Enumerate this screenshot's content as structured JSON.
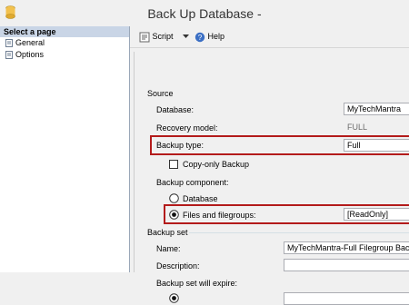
{
  "window": {
    "title": "Back Up Database -"
  },
  "left_pane": {
    "header": "Select a page",
    "items": [
      {
        "label": "General",
        "icon": "page-icon"
      },
      {
        "label": "Options",
        "icon": "page-icon"
      }
    ]
  },
  "toolbar": {
    "script_label": "Script",
    "help_label": "Help"
  },
  "source": {
    "section_label": "Source",
    "database_label": "Database:",
    "database_value": "MyTechMantra",
    "recovery_label": "Recovery model:",
    "recovery_value": "FULL",
    "backup_type_label": "Backup type:",
    "backup_type_value": "Full",
    "copy_only_label": "Copy-only Backup",
    "component_label": "Backup component:",
    "database_radio_label": "Database",
    "files_radio_label": "Files and filegroups:",
    "files_value": "[ReadOnly]"
  },
  "backup_set": {
    "section_label": "Backup set",
    "name_label": "Name:",
    "name_value": "MyTechMantra-Full Filegroup Backup",
    "description_label": "Description:",
    "description_value": "",
    "expire_label": "Backup set will expire:"
  },
  "colors": {
    "highlight_border": "#b31b1b",
    "selected_page_bg": "#c9d5e6"
  }
}
